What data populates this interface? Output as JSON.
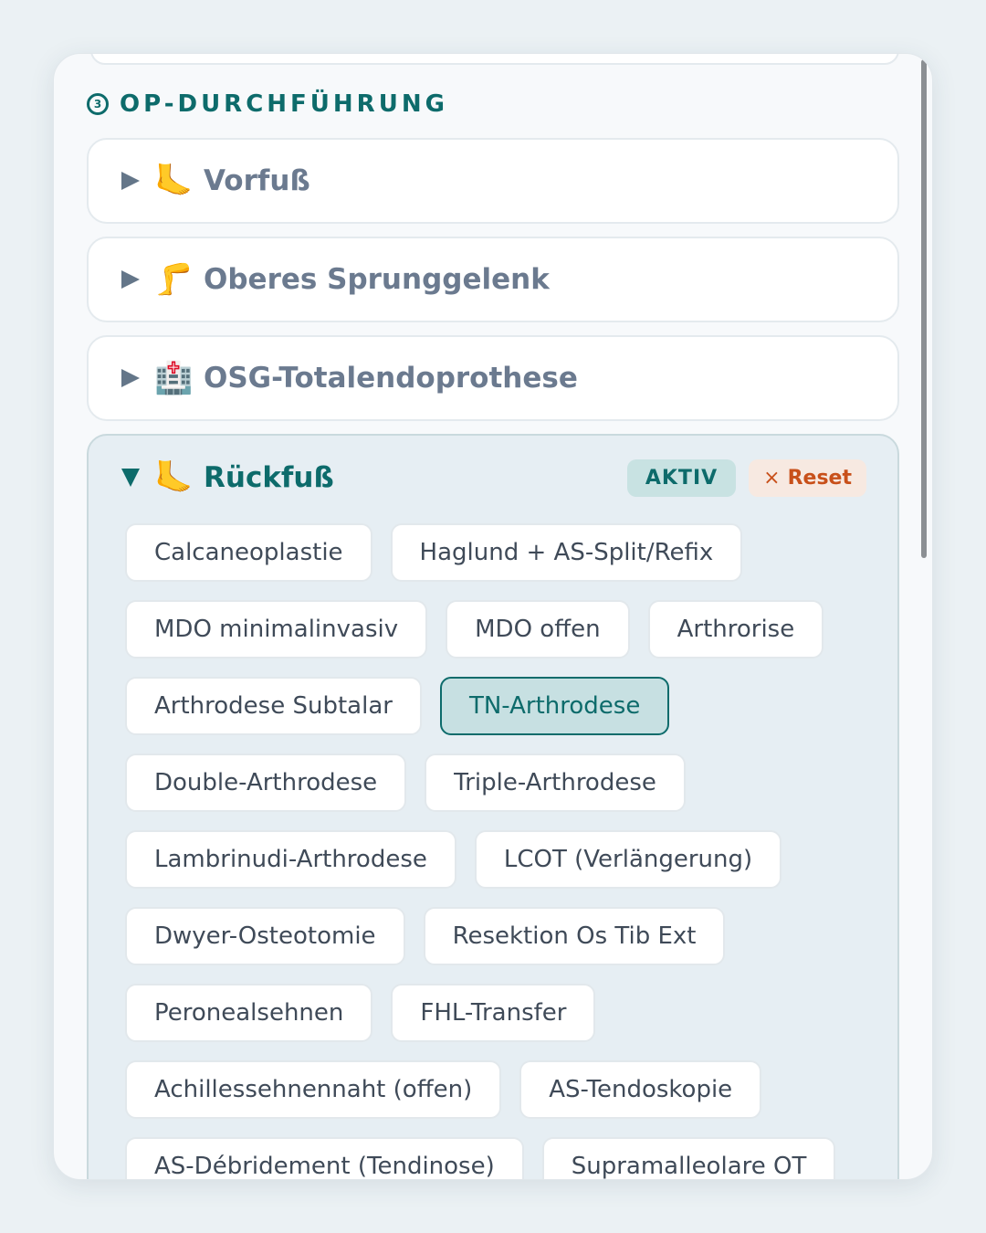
{
  "section": {
    "number": "3",
    "title": "OP-DURCHFÜHRUNG"
  },
  "accordions": [
    {
      "emoji": "🦶",
      "label": "Vorfuß"
    },
    {
      "emoji": "🦵",
      "label": "Oberes Sprunggelenk"
    },
    {
      "emoji": "🏥",
      "label": "OSG-Totalendoprothese"
    }
  ],
  "open_accordion": {
    "emoji": "🦶",
    "label": "Rückfuß",
    "badge": "AKTIV",
    "reset_icon": "×",
    "reset_label": "Reset",
    "procedures": [
      {
        "label": "Calcaneoplastie",
        "selected": false
      },
      {
        "label": "Haglund + AS-Split/Refix",
        "selected": false
      },
      {
        "label": "MDO minimalinvasiv",
        "selected": false
      },
      {
        "label": "MDO offen",
        "selected": false
      },
      {
        "label": "Arthrorise",
        "selected": false
      },
      {
        "label": "Arthrodese Subtalar",
        "selected": false
      },
      {
        "label": "TN-Arthrodese",
        "selected": true
      },
      {
        "label": "Double-Arthrodese",
        "selected": false
      },
      {
        "label": "Triple-Arthrodese",
        "selected": false
      },
      {
        "label": "Lambrinudi-Arthrodese",
        "selected": false
      },
      {
        "label": "LCOT (Verlängerung)",
        "selected": false
      },
      {
        "label": "Dwyer-Osteotomie",
        "selected": false
      },
      {
        "label": "Resektion Os Tib Ext",
        "selected": false
      },
      {
        "label": "Peronealsehnen",
        "selected": false
      },
      {
        "label": "FHL-Transfer",
        "selected": false
      },
      {
        "label": "Achillessehnennaht (offen)",
        "selected": false
      },
      {
        "label": "AS-Tendoskopie",
        "selected": false
      },
      {
        "label": "AS-Débridement (Tendinose)",
        "selected": false
      },
      {
        "label": "Supramalleolare OT",
        "selected": false
      }
    ]
  },
  "colors": {
    "accent": "#0d6b6b",
    "reset": "#c8501a"
  }
}
